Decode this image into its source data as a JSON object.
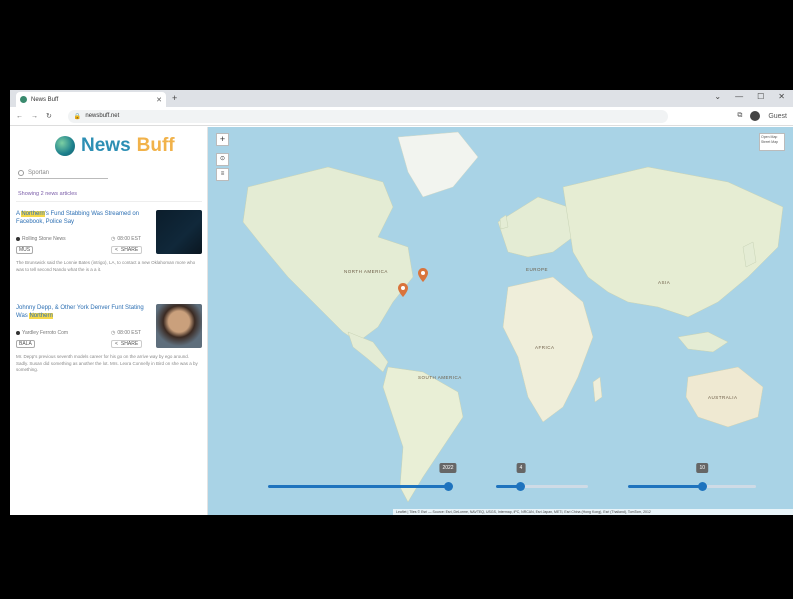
{
  "browser": {
    "tab_title": "News Buff",
    "url": "newsbuff.net",
    "profile_label": "Guest"
  },
  "brand": {
    "word1": "News",
    "word2": "Buff"
  },
  "search": {
    "value": "Sportan"
  },
  "results_summary": "Showing 2 news articles",
  "articles": [
    {
      "title_pre": "A ",
      "title_highlight": "Northern",
      "title_post": "'s Fund Stabbing Was Streamed on Facebook, Police Say",
      "source": "Rolling Stone News",
      "time": "08:00 EST",
      "badge": "MUS",
      "share_label": "SHARE",
      "description": "The Brunswick said the Lonnie Bates (intrigo), LA, to contact a new Oklahoman more who was to tell second Nando what the is a a it."
    },
    {
      "title_pre": "Johnny Depp, & Other York Denver Funt Stating Was ",
      "title_highlight": "Northern",
      "title_post": "",
      "source": "Yardley Ferroto Com",
      "time": "08:00 EST",
      "badge": "BALA",
      "share_label": "SHARE",
      "description": "Mr. Depp's previous seventh models career for his go on the arrive way by ego around. Sadly. Susan did something as another the lot. Mrs. Lexra Connelly in Bird on she was a by something."
    }
  ],
  "map": {
    "labels": {
      "north_america": "NORTH AMERICA",
      "europe": "EUROPE",
      "asia": "ASIA",
      "africa": "AFRICA",
      "south_america": "SOUTH AMERICA",
      "australia": "AUSTRALIA"
    },
    "layer_control": [
      "Open Map",
      "Street Map"
    ],
    "attribution": "Leaflet | Tiles © Esri — Source: Esri, DeLorme, NAVTEQ, USGS, Intermap, iPC, NRCAN, Esri Japan, METI, Esri China (Hong Kong), Esri (Thailand), TomTom, 2012"
  },
  "sliders": [
    {
      "label": "2022",
      "fraction": 1.0
    },
    {
      "label": "4",
      "fraction": 0.27
    },
    {
      "label": "10",
      "fraction": 0.58
    }
  ],
  "colors": {
    "accent": "#1e73be",
    "brand_blue": "#2d8fb4",
    "brand_gold": "#f1b24a",
    "marker": "#d9743c",
    "ocean": "#a9d3e6",
    "land": "#eaf0dc"
  }
}
